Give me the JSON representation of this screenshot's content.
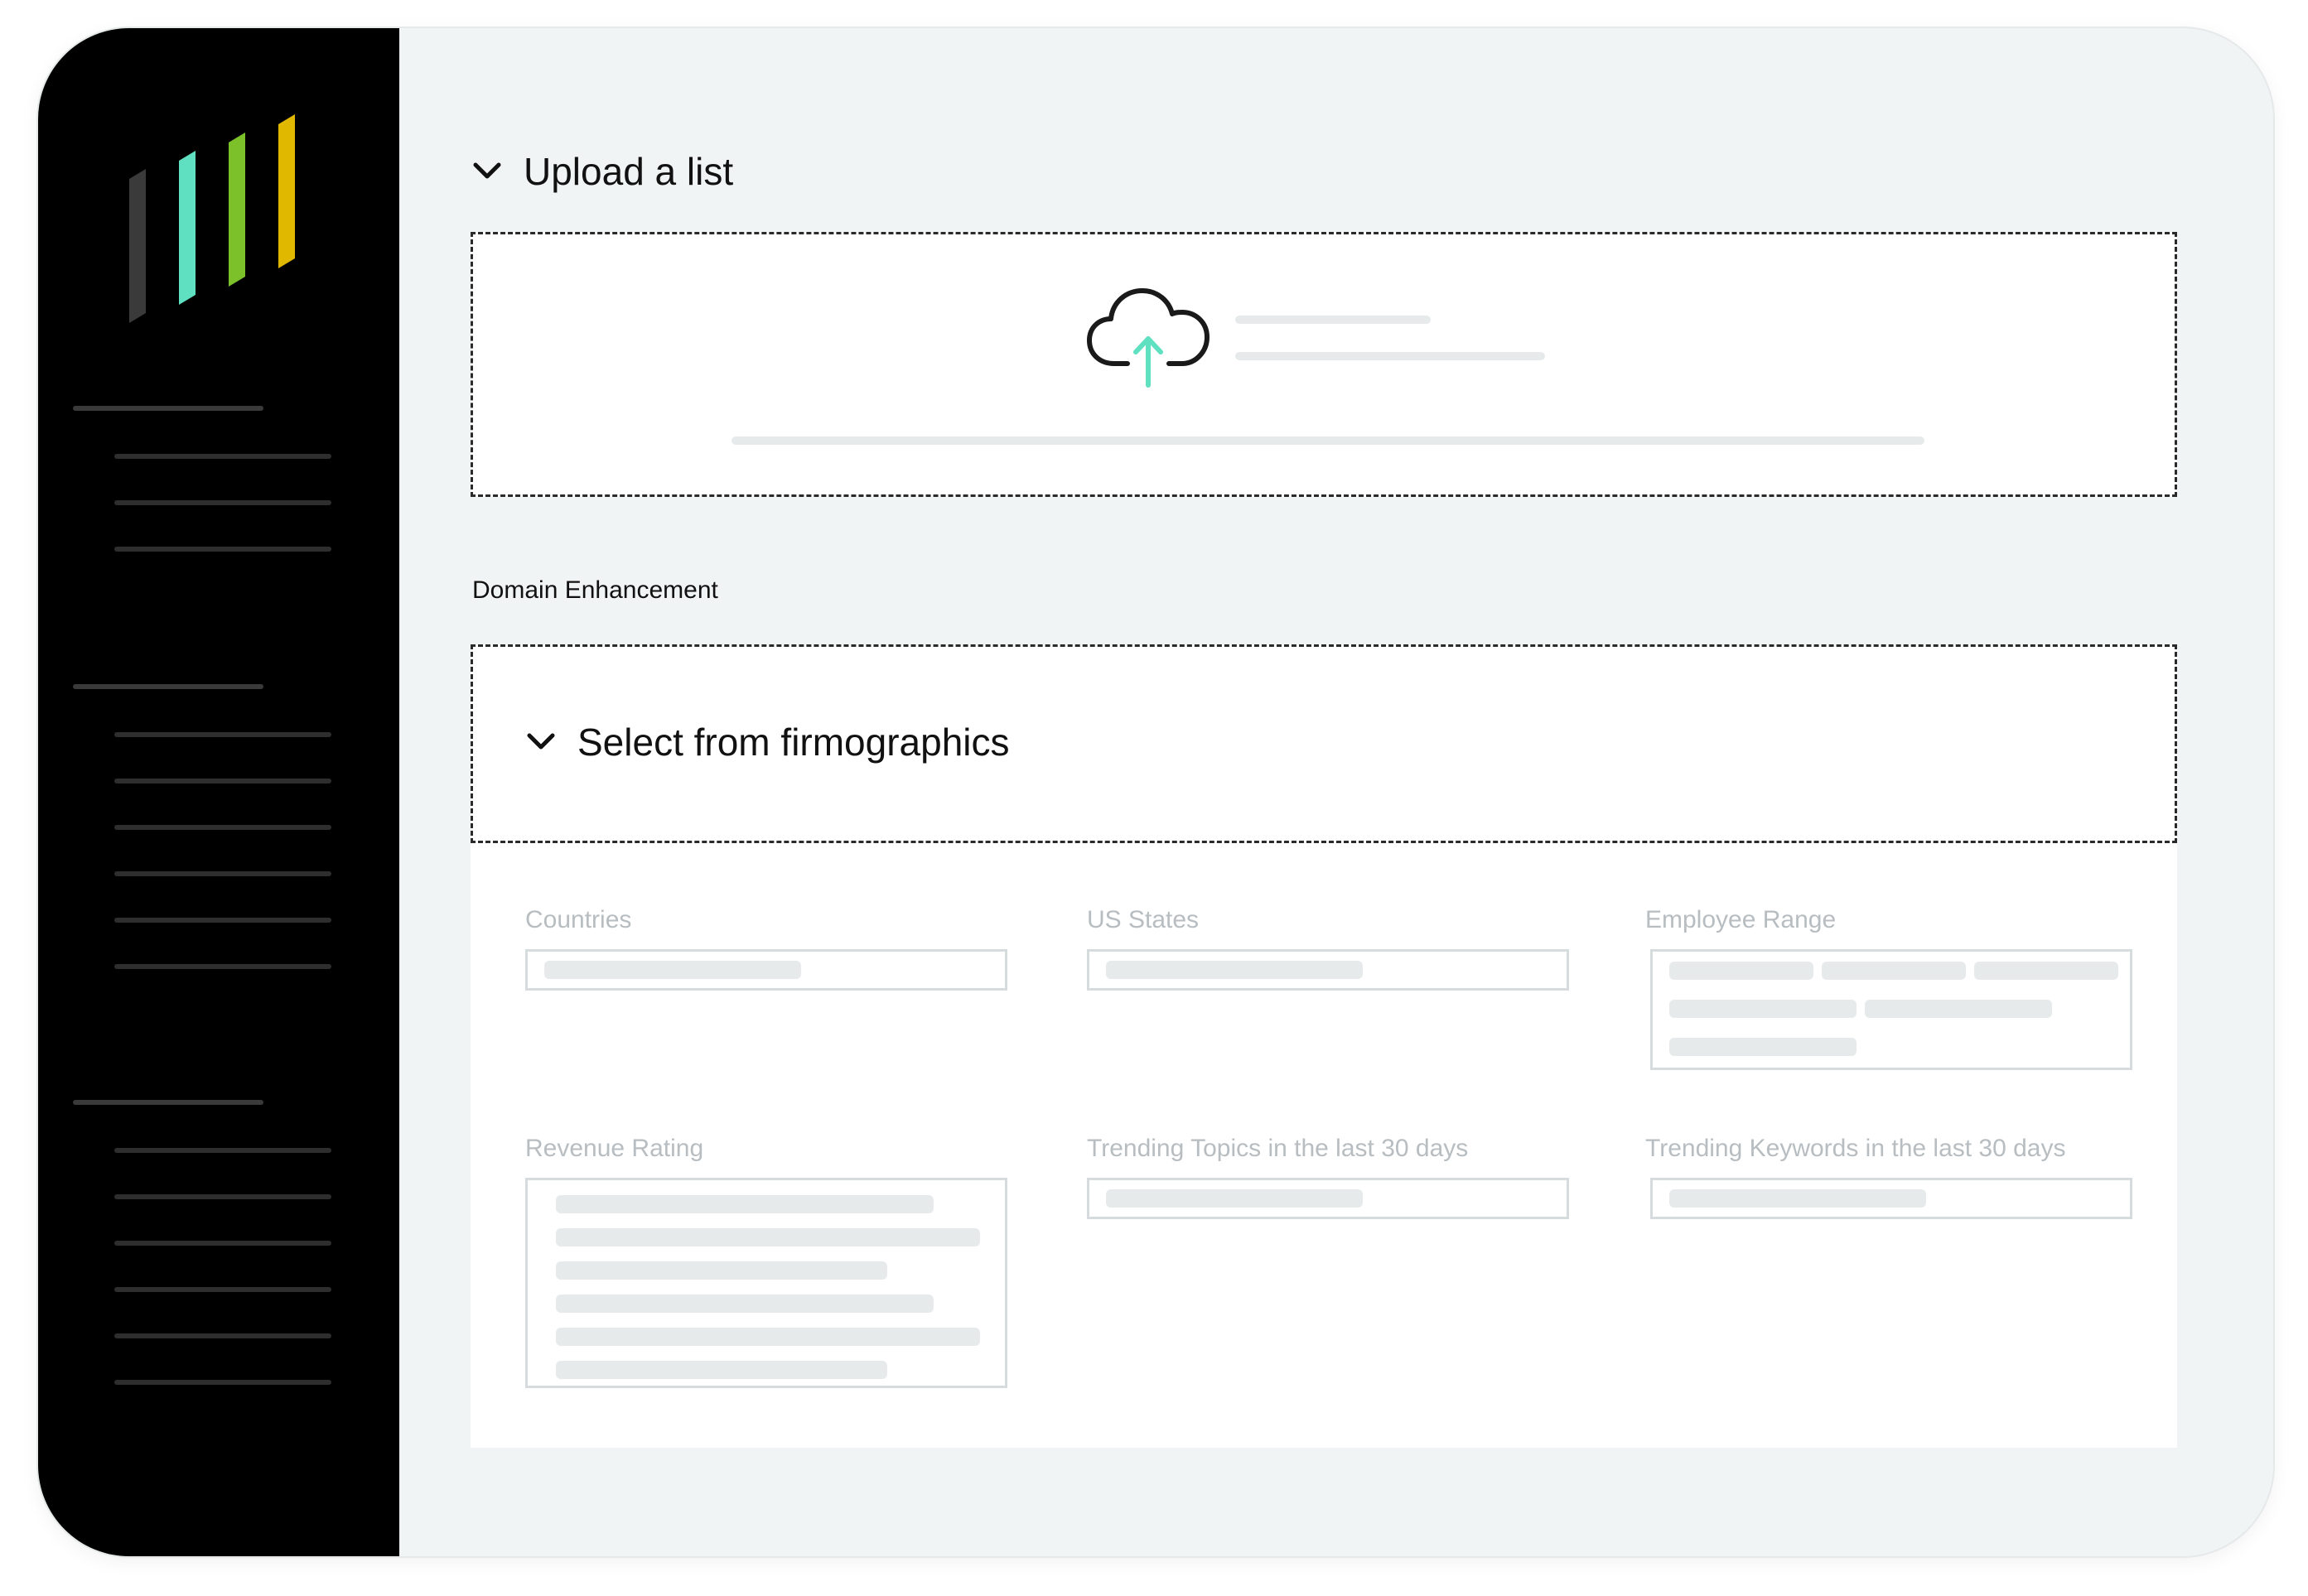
{
  "upload": {
    "title": "Upload a list",
    "icon": "cloud-upload-icon"
  },
  "domain_enhancement": {
    "label": "Domain Enhancement"
  },
  "firmographics": {
    "title": "Select from firmographics",
    "fields": [
      {
        "label": "Countries"
      },
      {
        "label": "US States"
      },
      {
        "label": "Employee Range"
      },
      {
        "label": "Revenue Rating"
      },
      {
        "label": "Trending Topics in the last 30 days"
      },
      {
        "label": "Trending Keywords in the last 30 days"
      }
    ]
  },
  "colors": {
    "sidebar": "#000000",
    "background": "#f1f4f4",
    "logo_bars": [
      "#3a3a3a",
      "#5fe0c0",
      "#7cc02a",
      "#e0b800"
    ],
    "accent": "#5fe0c0"
  }
}
